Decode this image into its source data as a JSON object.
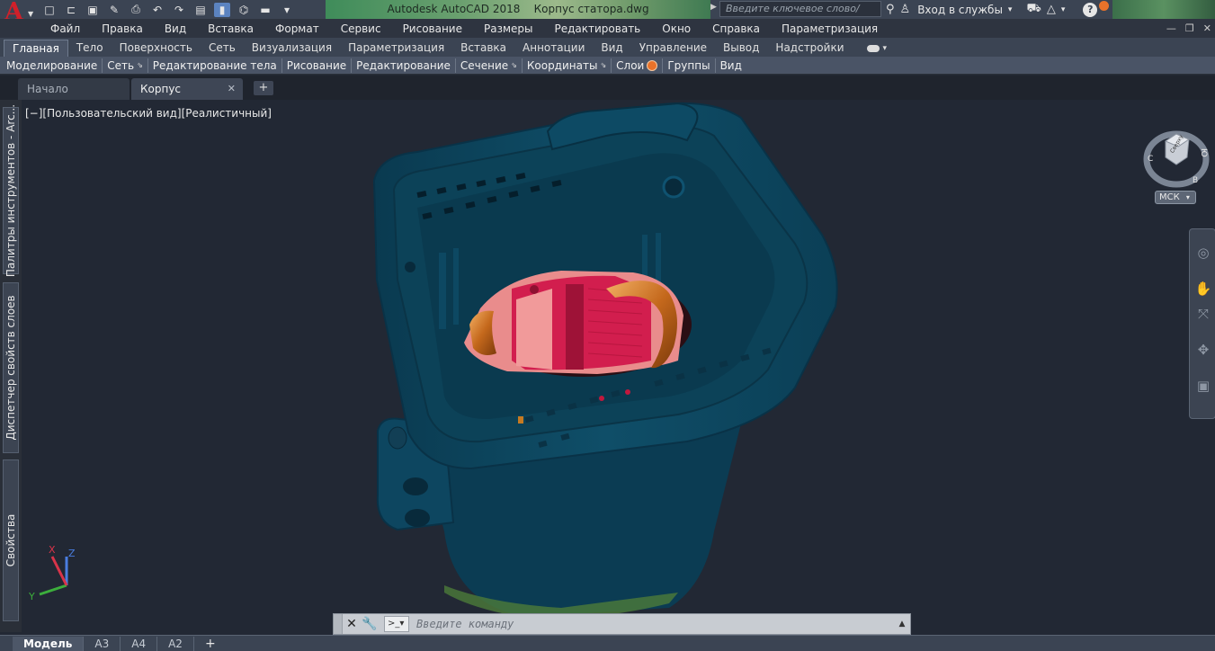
{
  "app": {
    "logo_letter": "A",
    "title": "Autodesk AutoCAD 2018    Корпус статора.dwg",
    "search_placeholder": "Введите ключевое слово/фразу",
    "login_label": "Вход в службы",
    "help_label": "?"
  },
  "qat": [
    "new-file-icon",
    "open-icon",
    "save-icon",
    "save-as-icon",
    "print-icon",
    "undo-icon",
    "redo-icon",
    "workspace-icon",
    "layer-icon",
    "properties-icon",
    "match-icon",
    "qat-menu-icon"
  ],
  "menu": [
    "Файл",
    "Правка",
    "Вид",
    "Вставка",
    "Формат",
    "Сервис",
    "Рисование",
    "Размеры",
    "Редактировать",
    "Окно",
    "Справка",
    "Параметризация"
  ],
  "ribbon_tabs": [
    {
      "label": "Главная",
      "active": true
    },
    {
      "label": "Тело"
    },
    {
      "label": "Поверхность"
    },
    {
      "label": "Сеть"
    },
    {
      "label": "Визуализация"
    },
    {
      "label": "Параметризация"
    },
    {
      "label": "Вставка"
    },
    {
      "label": "Аннотации"
    },
    {
      "label": "Вид"
    },
    {
      "label": "Управление"
    },
    {
      "label": "Вывод"
    },
    {
      "label": "Надстройки"
    }
  ],
  "ribbon_panels": [
    {
      "label": "Моделирование",
      "expand": false
    },
    {
      "label": "Сеть",
      "expand": true
    },
    {
      "label": "Редактирование тела",
      "expand": false
    },
    {
      "label": "Рисование",
      "expand": false
    },
    {
      "label": "Редактирование",
      "expand": false
    },
    {
      "label": "Сечение",
      "expand": true
    },
    {
      "label": "Координаты",
      "expand": true
    },
    {
      "label": "Слои",
      "expand": false
    },
    {
      "label": "Группы",
      "expand": false
    },
    {
      "label": "Вид",
      "expand": false
    }
  ],
  "doc_tabs": {
    "start": "Начало",
    "file": "Корпус статора*",
    "close": "✕",
    "add": "+"
  },
  "palettes": {
    "tools": "Палитры инструментов - Arc...",
    "layers": "Диспетчер свойств слоев",
    "props": "Свойства"
  },
  "viewport": {
    "view_label": "[−][Пользовательский вид][Реалистичный]",
    "ucs_label": "МСК",
    "viewcube_face": "Сверху",
    "compass": {
      "s": "С",
      "n": "Ю",
      "e": "В"
    },
    "ucs_axes": {
      "x": "X",
      "y": "Y",
      "z": "Z"
    }
  },
  "command_line": {
    "placeholder": "Введите  команду",
    "prompt_symbol": ">_▾"
  },
  "layout_tabs": [
    "Модель",
    "A3",
    "A4",
    "A2",
    "+"
  ],
  "colors": {
    "housing": "#0e4a63",
    "stator_red": "#d8204f",
    "stator_pink": "#e98c8c",
    "winding_copper": "#c9701e",
    "accent_orange": "#e8722a"
  }
}
